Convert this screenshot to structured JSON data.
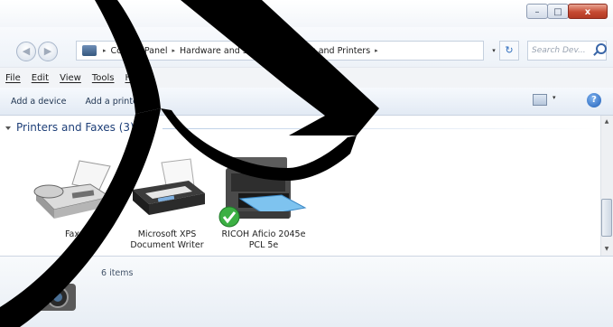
{
  "window": {
    "caption_minimize": "–",
    "caption_maximize": "□",
    "caption_close": "x"
  },
  "address": {
    "breadcrumbs": [
      "Control Panel",
      "Hardware and Sound",
      "Devices and Printers"
    ],
    "separator": "▸",
    "dropdown": "▾",
    "refresh": "↻",
    "search_placeholder": "Search Dev..."
  },
  "menu": {
    "items": [
      "File",
      "Edit",
      "View",
      "Tools",
      "Help"
    ]
  },
  "command_bar": {
    "add_device": "Add a device",
    "add_printer": "Add a printer",
    "views_arrow": "▾",
    "help": "?"
  },
  "group": {
    "title": "Printers and Faxes (3)"
  },
  "devices": [
    {
      "label": "Fax",
      "icon": "fax-icon"
    },
    {
      "label": "Microsoft XPS Document Writer",
      "icon": "printer-icon"
    },
    {
      "label": "RICOH Aficio 2045e PCL 5e",
      "icon": "multifunction-printer-icon",
      "default": true
    }
  ],
  "details": {
    "count": "6 items",
    "icon": "camera-icon"
  },
  "colors": {
    "group_header": "#1e3f78",
    "overlay": "#000000",
    "default_check": "#3cb043"
  }
}
